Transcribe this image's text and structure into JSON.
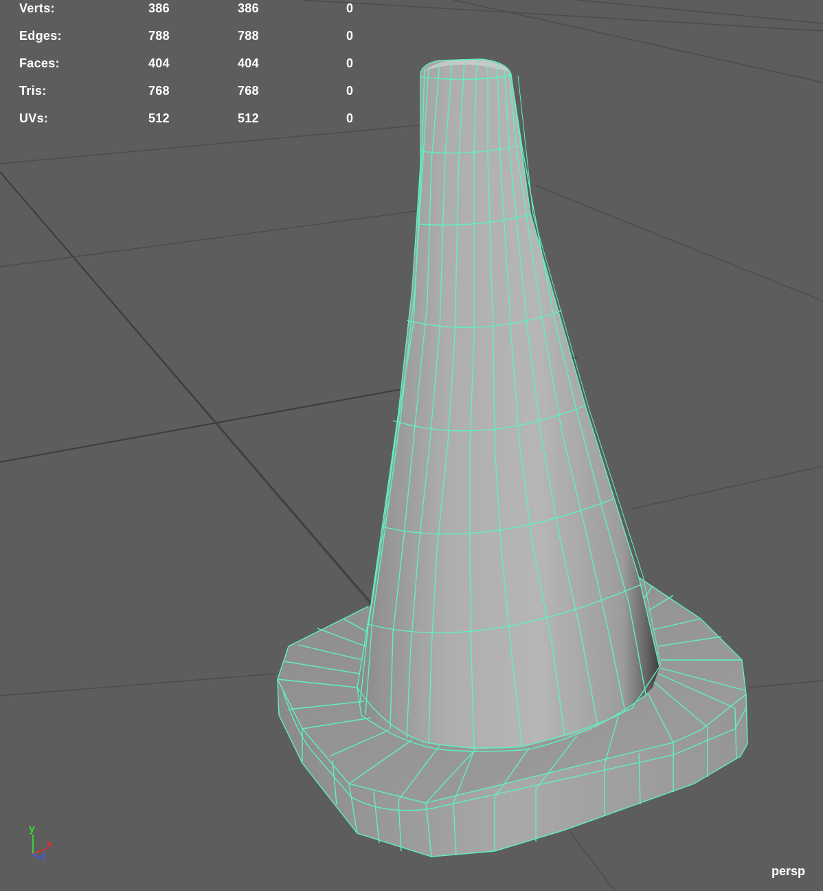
{
  "viewport": {
    "camera_name": "persp",
    "colors": {
      "background": "#5d5d5d",
      "grid_line": "#4a4a4a",
      "grid_axis": "#3a3a3a",
      "wireframe": "#5ef2bf",
      "mesh_light": "#b8b8b8",
      "mesh_dark": "#4e4e4e",
      "hud_text": "#ffffff"
    }
  },
  "hud": {
    "rows": [
      {
        "label": "Verts:",
        "total": "386",
        "selected": "386",
        "component": "0"
      },
      {
        "label": "Edges:",
        "total": "788",
        "selected": "788",
        "component": "0"
      },
      {
        "label": "Faces:",
        "total": "404",
        "selected": "404",
        "component": "0"
      },
      {
        "label": "Tris:",
        "total": "768",
        "selected": "768",
        "component": "0"
      },
      {
        "label": "UVs:",
        "total": "512",
        "selected": "512",
        "component": "0"
      }
    ]
  },
  "axis_gizmo": {
    "y_label": "y",
    "x_label": "x",
    "z_label": "z",
    "colors": {
      "y": "#3ad13a",
      "x": "#e03030",
      "z": "#3a5cff"
    }
  },
  "scene": {
    "object": "traffic-cone-mesh",
    "display_mode": "smooth shaded with wireframe"
  }
}
